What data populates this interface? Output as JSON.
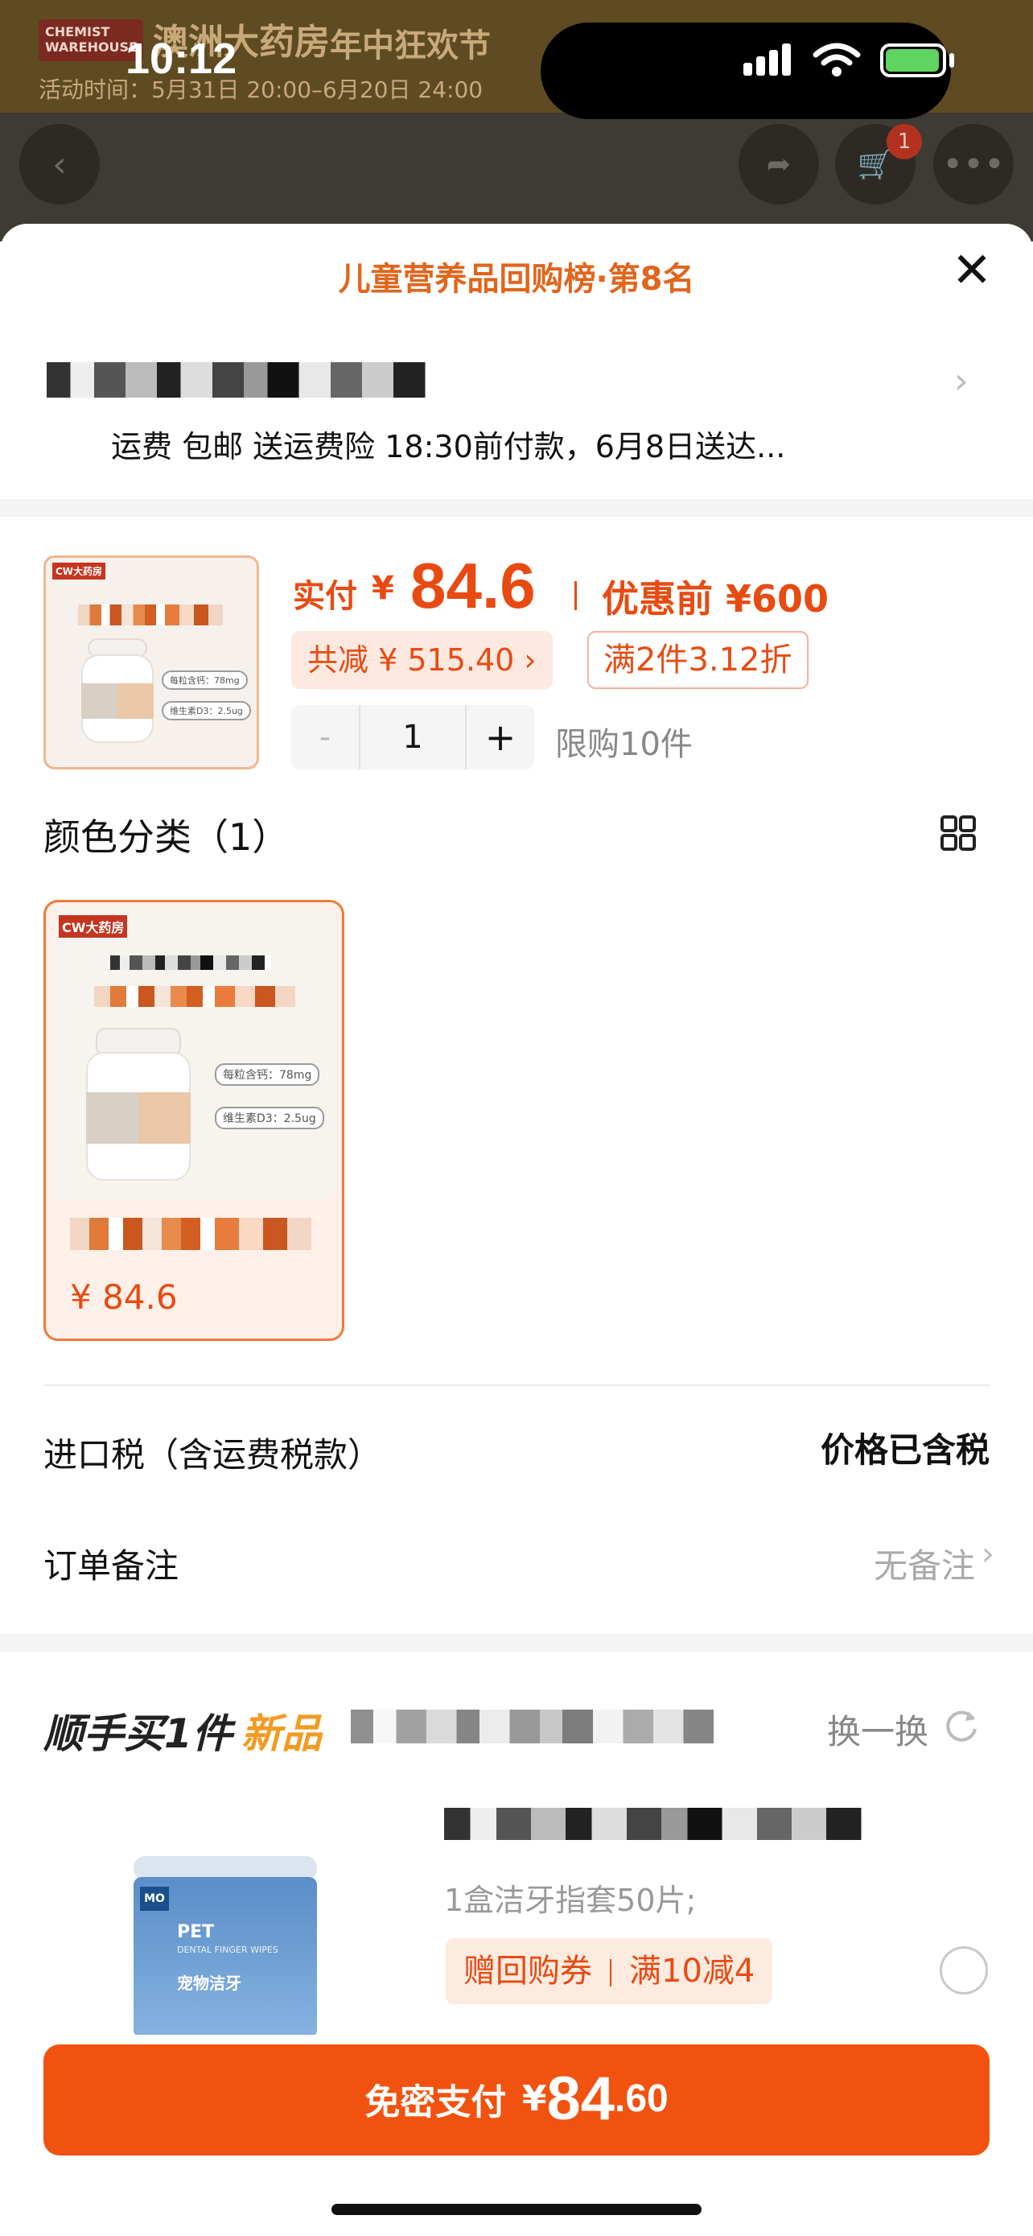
{
  "background": {
    "brand": "CHEMIST WAREHOUSE",
    "store": "澳洲大药房",
    "promo": "年中狂欢节",
    "event_time": "活动时间：5月31日 20:00–6月20日 24:00",
    "cart_badge": "1"
  },
  "status_bar": {
    "time": "10:12"
  },
  "sheet": {
    "title": "儿童营养品回购榜·第8名",
    "shipping": "运费 包邮 送运费险 18:30前付款，6月8日送达..."
  },
  "product": {
    "price_label": "实付",
    "currency": "¥",
    "price": "84.6",
    "before_price": "优惠前 ¥600",
    "saved": "共减 ¥ 515.40 ›",
    "discount_tag": "满2件3.12折",
    "quantity": "1",
    "minus": "-",
    "plus": "+",
    "limit": "限购10件",
    "thumb_brand": "CW大药房",
    "thumb_info": [
      "每粒含钙：78mg",
      "维生素D3：2.5ug"
    ]
  },
  "color_section": {
    "title": "颜色分类（1）",
    "option_price": "¥ 84.6"
  },
  "rows": {
    "tax_label": "进口税（含运费税款）",
    "tax_value": "价格已含税",
    "note_label": "订单备注",
    "note_value": "无备注"
  },
  "addon": {
    "title": "顺手买1件",
    "new_tag": "新品",
    "refresh": "换一换",
    "description": "1盒洁牙指套50片;",
    "coupon_left": "赠回购券",
    "coupon_right": "满10减4",
    "product_brand": "PET",
    "product_sub": "DENTAL FINGER WIPES",
    "product_cn": "宠物洁牙"
  },
  "pay": {
    "label": "免密支付",
    "currency": "¥",
    "amount_big": "84",
    "amount_small": ".60"
  },
  "colors": {
    "accent": "#f2520f",
    "accent_text": "#e84b12",
    "title_orange": "#e0661d",
    "new_tag": "#f39a22"
  }
}
